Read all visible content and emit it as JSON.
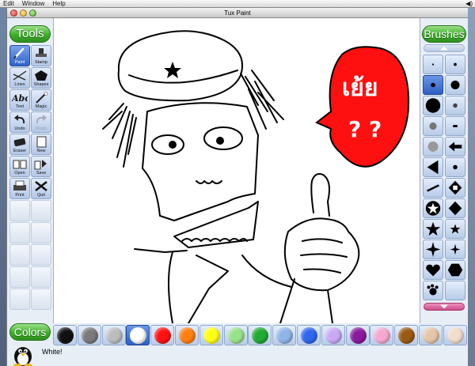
{
  "menubar": {
    "items": [
      "Edit",
      "Window",
      "Help"
    ]
  },
  "window": {
    "title": "Tux Paint"
  },
  "tools": {
    "title": "Tools",
    "items": [
      {
        "label": "Paint",
        "icon": "paintbrush-icon",
        "selected": true
      },
      {
        "label": "Stamp",
        "icon": "stamp-icon"
      },
      {
        "label": "Lines",
        "icon": "lines-icon"
      },
      {
        "label": "Shapes",
        "icon": "shapes-icon"
      },
      {
        "label": "Text",
        "icon": "text-icon"
      },
      {
        "label": "Magic",
        "icon": "magic-wand-icon"
      },
      {
        "label": "Undo",
        "icon": "undo-icon"
      },
      {
        "label": "Redo",
        "icon": "redo-icon",
        "disabled": true
      },
      {
        "label": "Eraser",
        "icon": "eraser-icon"
      },
      {
        "label": "New",
        "icon": "new-page-icon"
      },
      {
        "label": "Open",
        "icon": "open-icon"
      },
      {
        "label": "Save",
        "icon": "save-icon"
      },
      {
        "label": "Print",
        "icon": "printer-icon"
      },
      {
        "label": "Quit",
        "icon": "quit-icon"
      }
    ]
  },
  "brushes": {
    "title": "Brushes",
    "selected_index": 2
  },
  "colors": {
    "title": "Colors",
    "swatches": [
      "#111111",
      "#7a7a7a",
      "#bdbdbd",
      "#ffffff",
      "#ff1111",
      "#ff7f11",
      "#ffff11",
      "#99e28a",
      "#22aa33",
      "#8fb4e8",
      "#2f66f0",
      "#c9a9f4",
      "#8b1a9e",
      "#f7a8d0",
      "#9a5a12",
      "#e6c6a6",
      "#f2dccc"
    ],
    "selected_index": 3
  },
  "status": {
    "message": "White!"
  },
  "canvas": {
    "bubble_text": "เย้ย",
    "bubble_marks": "? ?"
  }
}
